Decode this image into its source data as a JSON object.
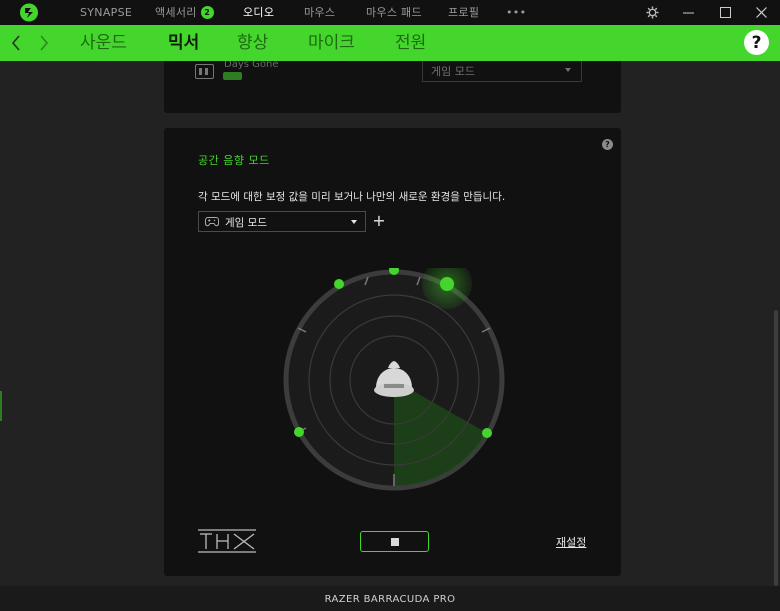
{
  "topbar": {
    "items": [
      {
        "label": "SYNAPSE"
      },
      {
        "label": "액세서리",
        "badge": "2"
      },
      {
        "label": "오디오",
        "active": true
      },
      {
        "label": "마우스"
      },
      {
        "label": "마우스 패드"
      },
      {
        "label": "프로필"
      },
      {
        "label": "•••"
      }
    ],
    "icons": [
      "razer-logo-icon",
      "settings-gear-icon",
      "minimize-icon",
      "maximize-icon",
      "close-icon"
    ]
  },
  "tabs": [
    {
      "label": "사운드"
    },
    {
      "label": "믹서",
      "active": true
    },
    {
      "label": "향상"
    },
    {
      "label": "마이크"
    },
    {
      "label": "전원"
    }
  ],
  "help_label": "?",
  "top_panel": {
    "app_name": "Days Gone",
    "app_tag": "",
    "mode_value": "게임 모드"
  },
  "spatial": {
    "title": "공간 음향 모드",
    "help_label": "?",
    "description": "각 모드에 대한 보정 값을 미리 보거나 나만의 새로운 환경을 만듭니다.",
    "selected_mode": "게임 모드",
    "add_label": "+",
    "logo_text": "THX",
    "reset_label": "재설정"
  },
  "colors": {
    "accent": "#44d62c",
    "background": "#222222",
    "panel": "#111111"
  },
  "status": {
    "device": "RAZER BARRACUDA PRO"
  }
}
